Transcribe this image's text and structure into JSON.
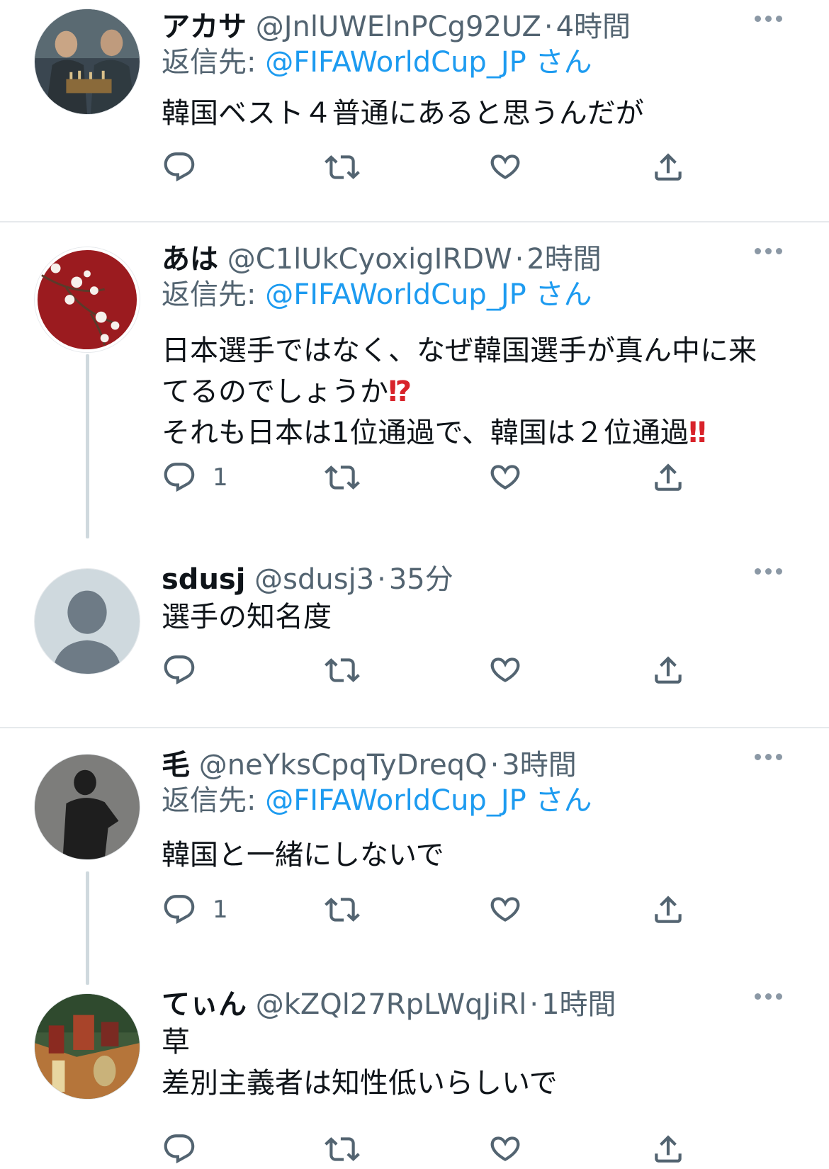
{
  "tweets": [
    {
      "name": "アカサ",
      "handle": "@JnlUWElnPCg92UZ",
      "time": "4時間",
      "reply_prefix": "返信先: ",
      "reply_mention": "@FIFAWorldCup_JP",
      "reply_suffix": " さん",
      "text": "韓国ベスト４普通にあると思うんだが",
      "reply_count": "",
      "avatar": "chess-players-photo"
    },
    {
      "name": "あは",
      "handle": "@C1lUkCyoxigIRDW",
      "time": "2時間",
      "reply_prefix": "返信先: ",
      "reply_mention": "@FIFAWorldCup_JP",
      "reply_suffix": " さん",
      "text_line1": "日本選手ではなく、なぜ韓国選手が真ん中に来",
      "text_line2": "てるのでしょうか",
      "text_emoji2": "⁉",
      "text_line3": "それも日本は1位通過で、韓国は２位通過",
      "text_emoji3": "‼",
      "reply_count": "1",
      "avatar": "red-plum-blossom"
    },
    {
      "name": "sdusj",
      "handle": "@sdusj3",
      "time": "35分",
      "text": "選手の知名度",
      "reply_count": "",
      "avatar": "default-avatar"
    },
    {
      "name": "毛",
      "handle": "@neYksCpqTyDreqQ",
      "time": "3時間",
      "reply_prefix": "返信先: ",
      "reply_mention": "@FIFAWorldCup_JP",
      "reply_suffix": " さん",
      "text": "韓国と一緒にしないで",
      "reply_count": "1",
      "avatar": "shadow-silhouette"
    },
    {
      "name": "てぃん",
      "handle": "@kZQl27RpLWqJiRl",
      "time": "1時間",
      "text_line1": "草",
      "text_line2": "差別主義者は知性低いらしいで",
      "reply_count": "",
      "avatar": "surreal-painting"
    }
  ],
  "dot_separator": "·",
  "colors": {
    "link": "#1d9bf0",
    "secondary": "#536471",
    "thread_line": "#cfd9de",
    "divider": "#e6e9ec"
  },
  "icons": [
    "reply-icon",
    "retweet-icon",
    "like-icon",
    "share-icon",
    "more-icon"
  ]
}
